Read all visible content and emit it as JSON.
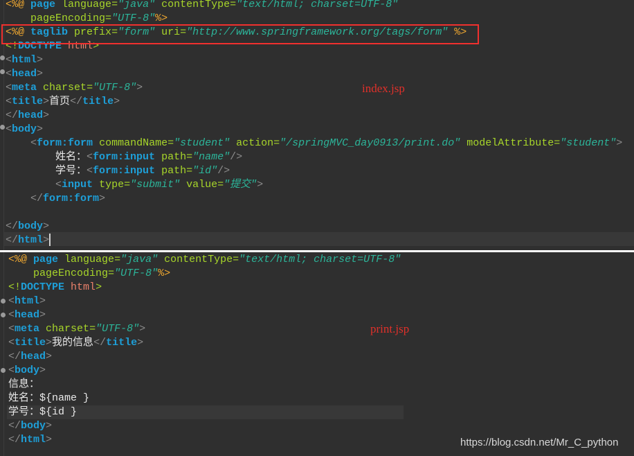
{
  "top": {
    "file_label": "index.jsp",
    "lines": [
      [
        [
          "d",
          "<%@ "
        ],
        [
          "t",
          "page"
        ],
        [
          "x",
          " "
        ],
        [
          "a",
          "language"
        ],
        [
          "a",
          "="
        ],
        [
          "s",
          "\"java\""
        ],
        [
          "x",
          " "
        ],
        [
          "a",
          "contentType"
        ],
        [
          "a",
          "="
        ],
        [
          "s",
          "\"text/html; charset=UTF-8\""
        ]
      ],
      [
        [
          "x",
          "    "
        ],
        [
          "a",
          "pageEncoding"
        ],
        [
          "a",
          "="
        ],
        [
          "s",
          "\"UTF-8\""
        ],
        [
          "d",
          "%>"
        ]
      ],
      [
        [
          "d",
          "<%@ "
        ],
        [
          "t",
          "taglib"
        ],
        [
          "x",
          " "
        ],
        [
          "a",
          "prefix"
        ],
        [
          "a",
          "="
        ],
        [
          "s",
          "\"form\""
        ],
        [
          "x",
          " "
        ],
        [
          "a",
          "uri"
        ],
        [
          "a",
          "="
        ],
        [
          "s",
          "\"http://www.springframework.org/tags/form\""
        ],
        [
          "x",
          " "
        ],
        [
          "d",
          "%>"
        ]
      ],
      [
        [
          "a",
          "<!"
        ],
        [
          "t",
          "DOCTYPE"
        ],
        [
          "x",
          " "
        ],
        [
          "dt",
          "html"
        ],
        [
          "a",
          ">"
        ]
      ],
      [
        [
          "b",
          "<"
        ],
        [
          "t",
          "html"
        ],
        [
          "b",
          ">"
        ]
      ],
      [
        [
          "b",
          "<"
        ],
        [
          "t",
          "head"
        ],
        [
          "b",
          ">"
        ]
      ],
      [
        [
          "b",
          "<"
        ],
        [
          "t",
          "meta"
        ],
        [
          "x",
          " "
        ],
        [
          "a",
          "charset"
        ],
        [
          "a",
          "="
        ],
        [
          "s",
          "\"UTF-8\""
        ],
        [
          "b",
          ">"
        ]
      ],
      [
        [
          "b",
          "<"
        ],
        [
          "t",
          "title"
        ],
        [
          "b",
          ">"
        ],
        [
          "x",
          "首页"
        ],
        [
          "b",
          "</"
        ],
        [
          "t",
          "title"
        ],
        [
          "b",
          ">"
        ]
      ],
      [
        [
          "b",
          "</"
        ],
        [
          "t",
          "head"
        ],
        [
          "b",
          ">"
        ]
      ],
      [
        [
          "b",
          "<"
        ],
        [
          "t",
          "body"
        ],
        [
          "b",
          ">"
        ]
      ],
      [
        [
          "x",
          "    "
        ],
        [
          "b",
          "<"
        ],
        [
          "t",
          "form:form"
        ],
        [
          "x",
          " "
        ],
        [
          "a",
          "commandName"
        ],
        [
          "a",
          "="
        ],
        [
          "s",
          "\"student\""
        ],
        [
          "x",
          " "
        ],
        [
          "a",
          "action"
        ],
        [
          "a",
          "="
        ],
        [
          "s",
          "\"/springMVC_day0913/print.do\""
        ],
        [
          "x",
          " "
        ],
        [
          "a",
          "modelAttribute"
        ],
        [
          "a",
          "="
        ],
        [
          "s",
          "\"student\""
        ],
        [
          "b",
          ">"
        ]
      ],
      [
        [
          "x",
          "        姓名："
        ],
        [
          "b",
          "<"
        ],
        [
          "t",
          "form:input"
        ],
        [
          "x",
          " "
        ],
        [
          "a",
          "path"
        ],
        [
          "a",
          "="
        ],
        [
          "s",
          "\"name\""
        ],
        [
          "b",
          "/>"
        ]
      ],
      [
        [
          "x",
          "        学号："
        ],
        [
          "b",
          "<"
        ],
        [
          "t",
          "form:input"
        ],
        [
          "x",
          " "
        ],
        [
          "a",
          "path"
        ],
        [
          "a",
          "="
        ],
        [
          "s",
          "\"id\""
        ],
        [
          "b",
          "/>"
        ]
      ],
      [
        [
          "x",
          "        "
        ],
        [
          "b",
          "<"
        ],
        [
          "t",
          "input"
        ],
        [
          "x",
          " "
        ],
        [
          "a",
          "type"
        ],
        [
          "a",
          "="
        ],
        [
          "s",
          "\"submit\""
        ],
        [
          "x",
          " "
        ],
        [
          "a",
          "value"
        ],
        [
          "a",
          "="
        ],
        [
          "s",
          "\"提交\""
        ],
        [
          "b",
          ">"
        ]
      ],
      [
        [
          "x",
          "    "
        ],
        [
          "b",
          "</"
        ],
        [
          "t",
          "form:form"
        ],
        [
          "b",
          ">"
        ]
      ],
      [],
      [
        [
          "b",
          "</"
        ],
        [
          "t",
          "body"
        ],
        [
          "b",
          ">"
        ]
      ],
      [
        [
          "b",
          "</"
        ],
        [
          "t",
          "html"
        ],
        [
          "b",
          ">"
        ]
      ]
    ]
  },
  "bottom": {
    "file_label": "print.jsp",
    "lines": [
      [
        [
          "d",
          "<%@ "
        ],
        [
          "t",
          "page"
        ],
        [
          "x",
          " "
        ],
        [
          "a",
          "language"
        ],
        [
          "a",
          "="
        ],
        [
          "s",
          "\"java\""
        ],
        [
          "x",
          " "
        ],
        [
          "a",
          "contentType"
        ],
        [
          "a",
          "="
        ],
        [
          "s",
          "\"text/html; charset=UTF-8\""
        ]
      ],
      [
        [
          "x",
          "    "
        ],
        [
          "a",
          "pageEncoding"
        ],
        [
          "a",
          "="
        ],
        [
          "s",
          "\"UTF-8\""
        ],
        [
          "d",
          "%>"
        ]
      ],
      [
        [
          "a",
          "<!"
        ],
        [
          "t",
          "DOCTYPE"
        ],
        [
          "x",
          " "
        ],
        [
          "dt",
          "html"
        ],
        [
          "a",
          ">"
        ]
      ],
      [
        [
          "b",
          "<"
        ],
        [
          "t",
          "html"
        ],
        [
          "b",
          ">"
        ]
      ],
      [
        [
          "b",
          "<"
        ],
        [
          "t",
          "head"
        ],
        [
          "b",
          ">"
        ]
      ],
      [
        [
          "b",
          "<"
        ],
        [
          "t",
          "meta"
        ],
        [
          "x",
          " "
        ],
        [
          "a",
          "charset"
        ],
        [
          "a",
          "="
        ],
        [
          "s",
          "\"UTF-8\""
        ],
        [
          "b",
          ">"
        ]
      ],
      [
        [
          "b",
          "<"
        ],
        [
          "t",
          "title"
        ],
        [
          "b",
          ">"
        ],
        [
          "x",
          "我的信息"
        ],
        [
          "b",
          "</"
        ],
        [
          "t",
          "title"
        ],
        [
          "b",
          ">"
        ]
      ],
      [
        [
          "b",
          "</"
        ],
        [
          "t",
          "head"
        ],
        [
          "b",
          ">"
        ]
      ],
      [
        [
          "b",
          "<"
        ],
        [
          "t",
          "body"
        ],
        [
          "b",
          ">"
        ]
      ],
      [
        [
          "x",
          "信息："
        ]
      ],
      [
        [
          "x",
          "姓名：${name }"
        ]
      ],
      [
        [
          "x",
          "学号：${id }"
        ]
      ],
      [
        [
          "b",
          "</"
        ],
        [
          "t",
          "body"
        ],
        [
          "b",
          ">"
        ]
      ],
      [
        [
          "b",
          "</"
        ],
        [
          "t",
          "html"
        ],
        [
          "b",
          ">"
        ]
      ]
    ]
  },
  "watermark": "https://blog.csdn.net/Mr_C_python",
  "colors": {
    "background": "#2f2f2f",
    "tag": "#1e9fd8",
    "attribute": "#a8d62a",
    "string": "#2cb59a",
    "directive": "#f0a830",
    "annotation": "#e0302a"
  }
}
